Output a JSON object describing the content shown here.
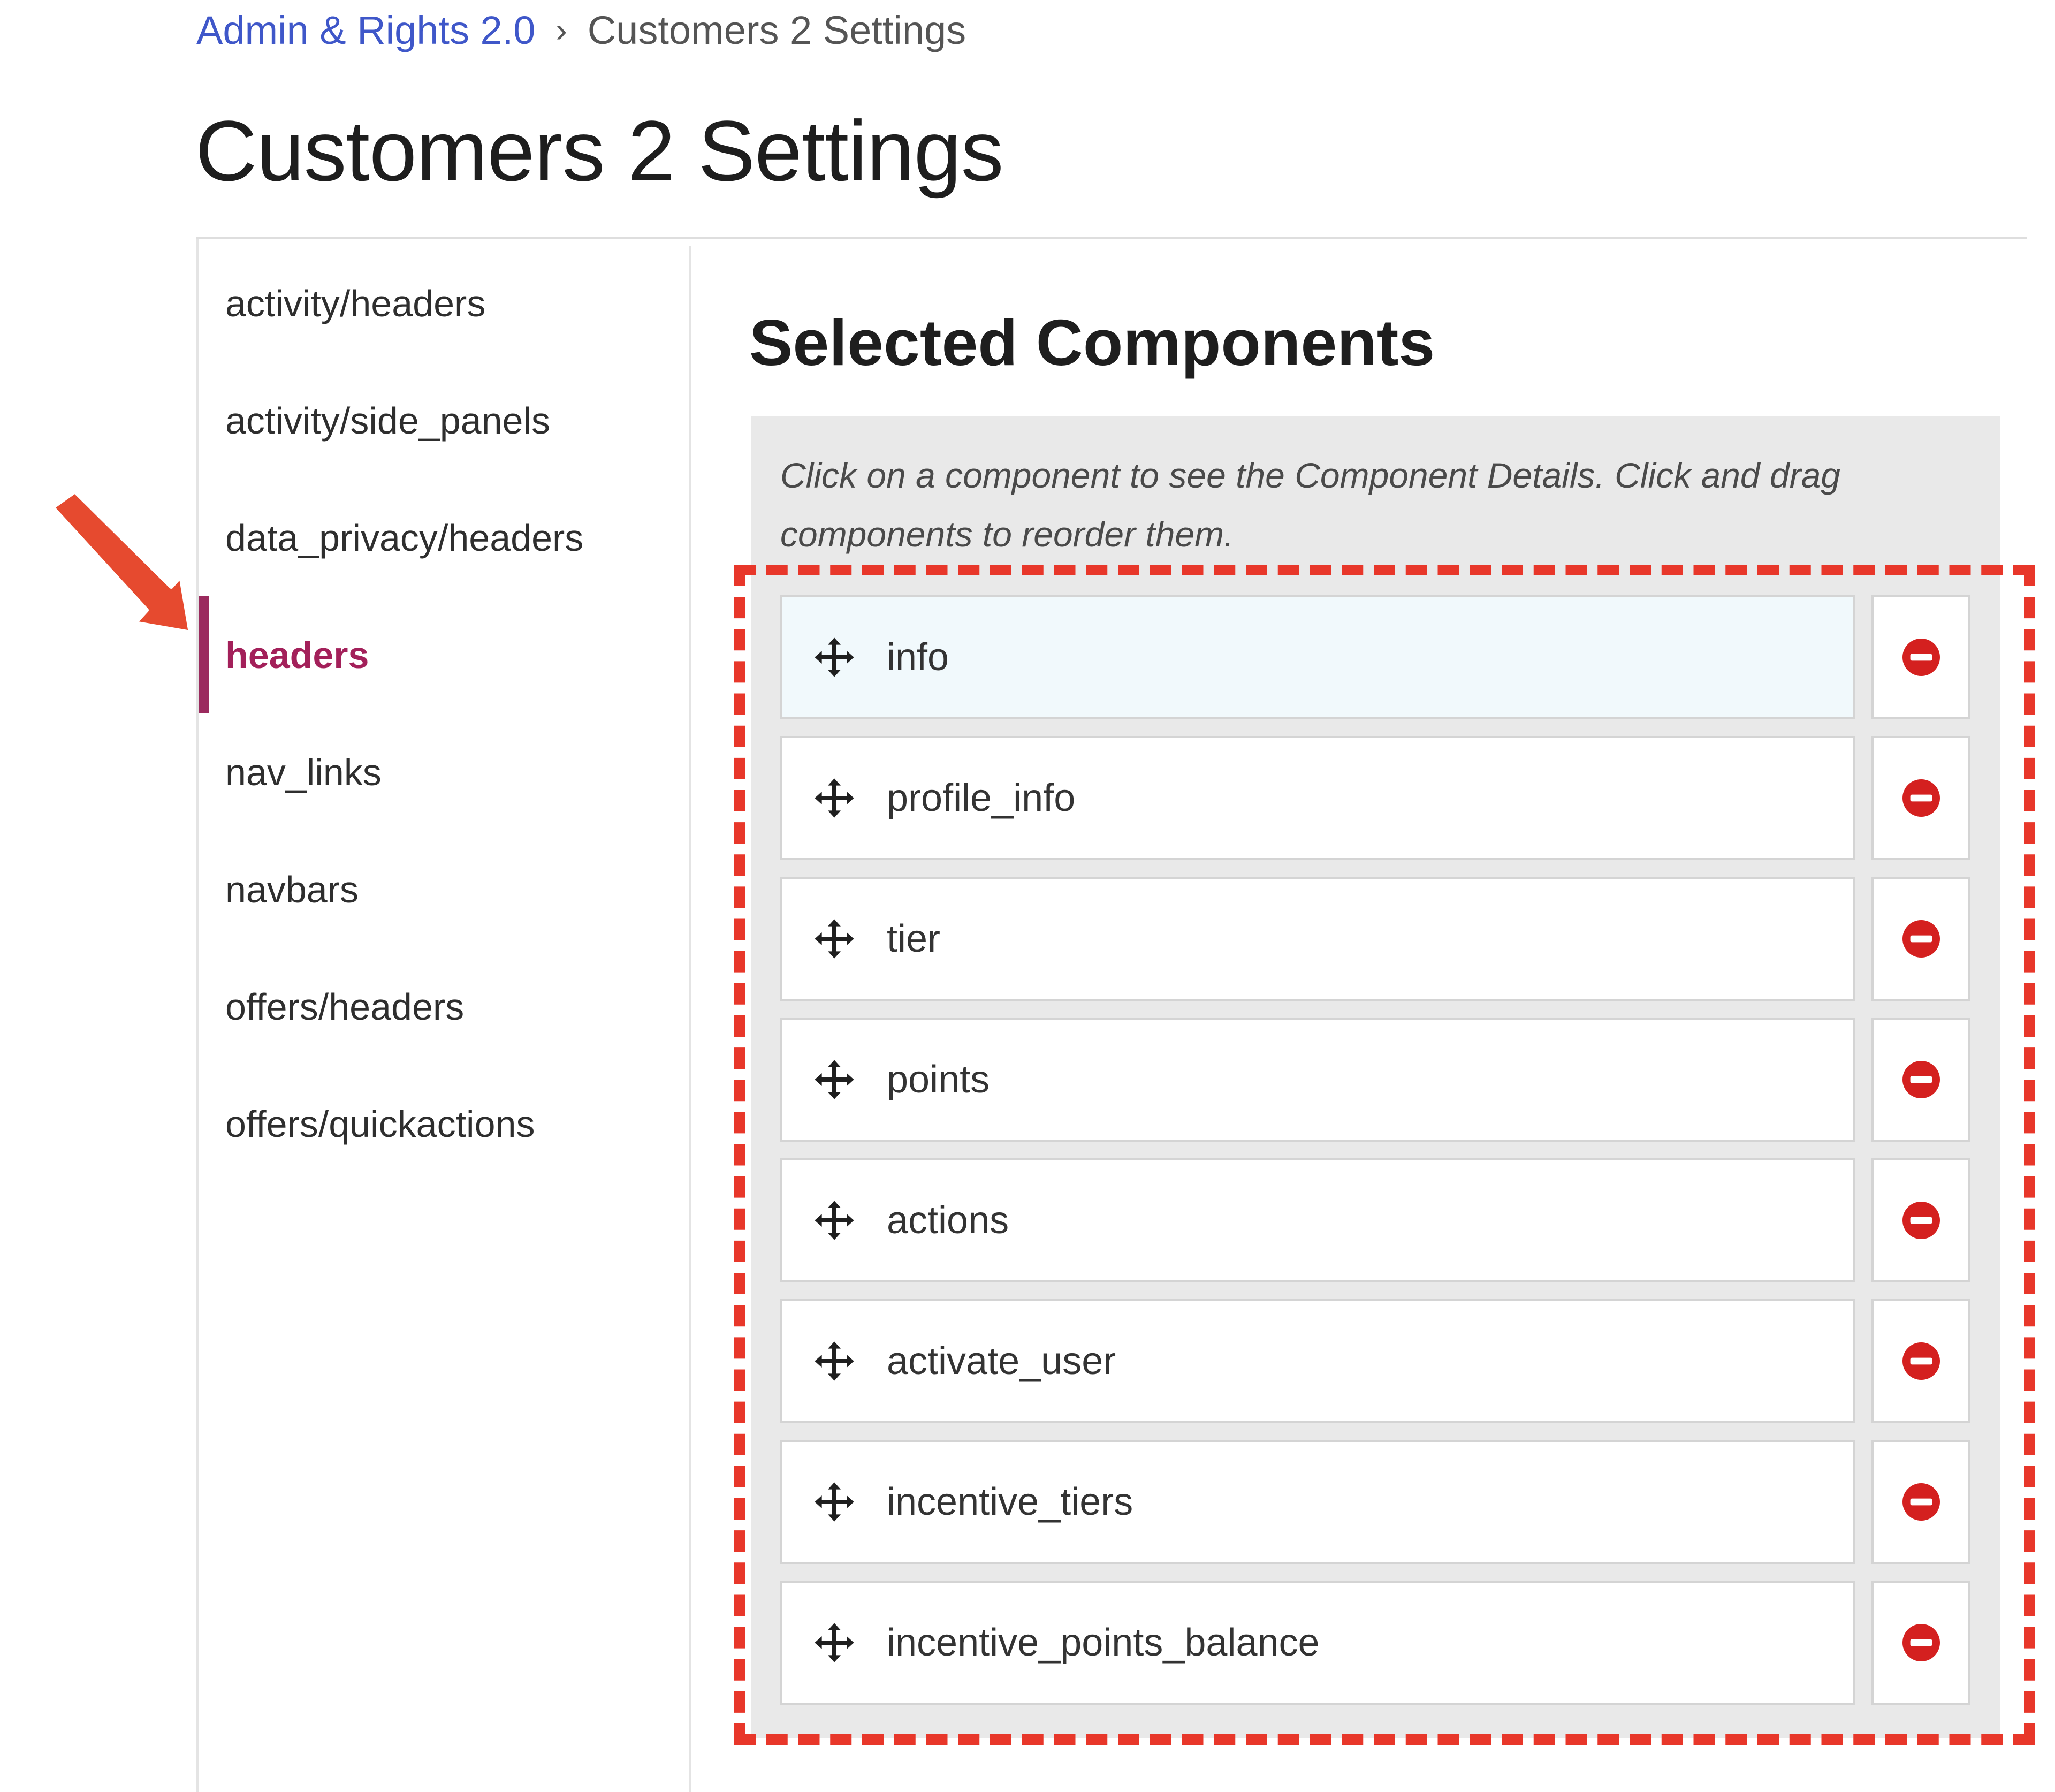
{
  "breadcrumb": {
    "parent": "Admin & Rights 2.0",
    "separator": "›",
    "current": "Customers 2 Settings"
  },
  "page": {
    "title": "Customers 2 Settings"
  },
  "sidebar": {
    "items": [
      {
        "label": "activity/headers",
        "active": false
      },
      {
        "label": "activity/side_panels",
        "active": false
      },
      {
        "label": "data_privacy/headers",
        "active": false
      },
      {
        "label": "headers",
        "active": true
      },
      {
        "label": "nav_links",
        "active": false
      },
      {
        "label": "navbars",
        "active": false
      },
      {
        "label": "offers/headers",
        "active": false
      },
      {
        "label": "offers/quickactions",
        "active": false
      }
    ]
  },
  "main": {
    "section_title": "Selected Components",
    "hint": "Click on a component to see the Component Details. Click and drag components to reorder them.",
    "components": [
      {
        "label": "info",
        "selected": true
      },
      {
        "label": "profile_info",
        "selected": false
      },
      {
        "label": "tier",
        "selected": false
      },
      {
        "label": "points",
        "selected": false
      },
      {
        "label": "actions",
        "selected": false
      },
      {
        "label": "activate_user",
        "selected": false
      },
      {
        "label": "incentive_tiers",
        "selected": false
      },
      {
        "label": "incentive_points_balance",
        "selected": false
      }
    ]
  },
  "icons": {
    "drag": "move-icon",
    "remove": "remove-circle-icon",
    "annotation": "arrow-icon"
  },
  "colors": {
    "link": "#3f57c9",
    "active_nav": "#a3205a",
    "active_bar": "#9b2a5e",
    "remove": "#d4201f",
    "annotation": "#e8372a",
    "selected_row": "#f1f9fc"
  }
}
